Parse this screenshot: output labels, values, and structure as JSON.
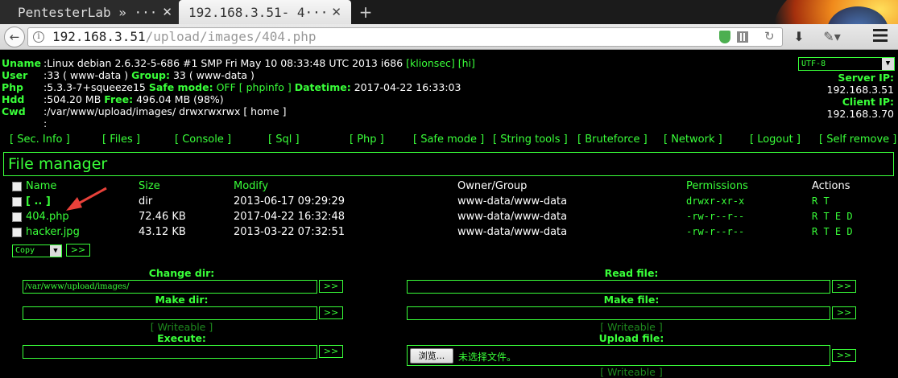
{
  "browser": {
    "tabs": [
      {
        "label": "PentesterLab » ···"
      },
      {
        "label": "192.168.3.51- 4···"
      }
    ],
    "url_host": "192.168.3.51",
    "url_path": "/upload/images/404.php"
  },
  "sysinfo": {
    "rows": [
      {
        "key": "Uname",
        "value": ":Linux debian 2.6.32-5-686 #1 SMP Fri May 10 08:33:48 UTC 2013 i686 ",
        "extra": "[klionsec] [hi]"
      },
      {
        "key": "User",
        "value": ":33 ( www-data ) ",
        "group_label": "Group:",
        "group_value": " 33 ( www-data )"
      },
      {
        "key": "Php",
        "value": ":5.3.3-7+squeeze15 ",
        "safe_label": "Safe mode:",
        "safe_value": " OFF",
        "phpinfo": " [ phpinfo ] ",
        "dt_label": "Datetime:",
        "dt_value": " 2017-04-22 16:33:03"
      },
      {
        "key": "Hdd",
        "value": ":504.20 MB ",
        "free_label": "Free:",
        "free_value": " 496.04 MB (98%)"
      },
      {
        "key": "Cwd",
        "value": ":/var/www/upload/images/ drwxrwxrwx [ home ]"
      },
      {
        "key": "",
        "value": ":"
      }
    ],
    "server_ip_label": "Server IP:",
    "server_ip": "192.168.3.51",
    "client_ip_label": "Client IP:",
    "client_ip": "192.168.3.70",
    "encoding": "UTF-8"
  },
  "menu": [
    "[ Sec. Info ]",
    "[ Files ]",
    "[ Console ]",
    "[ Sql ]",
    "[ Php ]",
    "[ Safe mode ]",
    "[ String tools ]",
    "[ Bruteforce ]",
    "[ Network ]",
    "[ Logout ]",
    "[ Self remove ]"
  ],
  "file_manager": {
    "title": "File manager",
    "columns": {
      "name": "Name",
      "size": "Size",
      "modify": "Modify",
      "owner": "Owner/Group",
      "perms": "Permissions",
      "actions": "Actions"
    },
    "rows": [
      {
        "name": "[ .. ]",
        "size": "dir",
        "modify": "2013-06-17 09:29:29",
        "owner": "www-data/www-data",
        "perms": "drwxr-xr-x",
        "actions": "R T"
      },
      {
        "name": "404.php",
        "size": "72.46 KB",
        "modify": "2017-04-22 16:32:48",
        "owner": "www-data/www-data",
        "perms": "-rw-r--r--",
        "actions": "R T E D"
      },
      {
        "name": "hacker.jpg",
        "size": "43.12 KB",
        "modify": "2013-03-22 07:32:51",
        "owner": "www-data/www-data",
        "perms": "-rw-r--r--",
        "actions": "R T E D"
      }
    ],
    "copy_action": "Copy",
    "go_label": ">>"
  },
  "panels": {
    "change_dir": {
      "label": "Change dir:",
      "value": "/var/www/upload/images/"
    },
    "make_dir": {
      "label": "Make dir:",
      "value": ""
    },
    "writeable": "[ Writeable ]",
    "execute": {
      "label": "Execute:",
      "value": ""
    },
    "read_file": {
      "label": "Read file:",
      "value": ""
    },
    "make_file": {
      "label": "Make file:",
      "value": ""
    },
    "upload_file": {
      "label": "Upload file:",
      "browse": "浏览...",
      "no_file": "未选择文件。"
    }
  },
  "colors": {
    "accent": "#39ff39",
    "background": "#000000",
    "dim_green": "#1e8a1e"
  }
}
